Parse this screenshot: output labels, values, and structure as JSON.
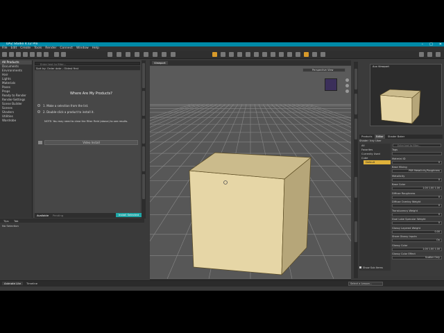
{
  "app": {
    "title": "DAZ Studio 4.12 Pro"
  },
  "menu": [
    "File",
    "Edit",
    "Create",
    "Tools",
    "Render",
    "Connect",
    "Window",
    "Help"
  ],
  "left_panel": {
    "categories": [
      "All Products",
      "Documents",
      "Environments",
      "Hair",
      "Lights",
      "Materials",
      "Poses",
      "Props",
      "Ready to Render",
      "Render-Settings",
      "Scene Builder",
      "Scenes",
      "Shaders",
      "Utilities",
      "Wardrobe"
    ],
    "search_placeholder": "Enter text to filter...",
    "sort_label": "Sort by: Order date - Oldest first",
    "welcome_title": "Where Are My Products?",
    "step1": "1. Make a selection from the list.",
    "step2": "2. Double-click a product to install it.",
    "note": "NOTE: You may need to clear the Filter Field (above) to see results.",
    "video_button": "Video Install",
    "tab_available": "Available",
    "tab_pending": "Pending",
    "install_button": "Install Selected",
    "bottom_tabs": [
      "Tips",
      "Tab"
    ],
    "no_selection": "No Selection"
  },
  "viewport": {
    "tab_label": "Viewport",
    "camera_label": "Perspective View",
    "cube_color": "#e3d3a1",
    "bottom_tabs": [
      "Animate Lite",
      "Timeline"
    ]
  },
  "right_panel": {
    "aux_label": "Aux Viewport",
    "tabs": [
      "Products",
      "Editor",
      "Shader Baker"
    ],
    "surface_header": "Shader: Iray Uber",
    "filter_placeholder": "Enter text to filter...",
    "surface_items": [
      "All",
      "Favorites",
      "Currently Used"
    ],
    "node_name": "Cube",
    "default_label": "Default",
    "show_sub_items": "Show Sub Items",
    "tool_select": "Select a Lesson...",
    "properties": [
      {
        "name": "Tags",
        "value": ""
      },
      {
        "name": "Material ID",
        "value": "0"
      },
      {
        "name": "Base Mixing",
        "value": "PBR Metallicity/Roughness"
      },
      {
        "name": "Metallicity",
        "value": "0"
      },
      {
        "name": "Base Color",
        "value": "1.00  1.00  1.00"
      },
      {
        "name": "Diffuse Roughness",
        "value": "0"
      },
      {
        "name": "Diffuse Overlay Weight",
        "value": "0"
      },
      {
        "name": "Translucency Weight",
        "value": "0"
      },
      {
        "name": "Dual Lobe Specular Weight",
        "value": "0"
      },
      {
        "name": "Glossy Layered Weight",
        "value": "0.00"
      },
      {
        "name": "Share Glossy Inputs",
        "value": "On"
      },
      {
        "name": "Glossy Color",
        "value": "1.00  1.00  1.00"
      },
      {
        "name": "Glossy Color Effect",
        "value": "Scatter Only"
      }
    ]
  }
}
